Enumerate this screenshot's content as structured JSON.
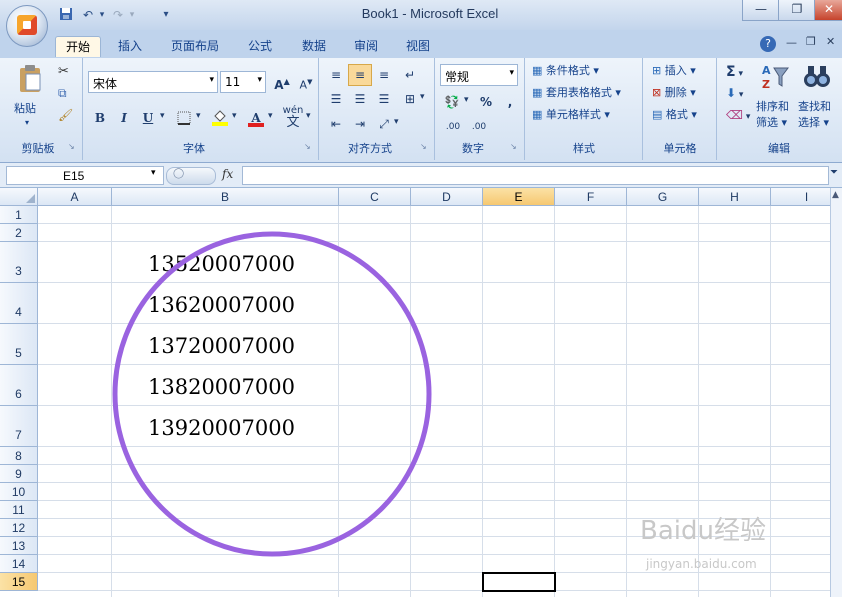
{
  "window": {
    "title": "Book1 - Microsoft Excel"
  },
  "quick_access": {
    "save_icon": "save-icon",
    "undo_icon": "undo-icon",
    "redo_icon": "redo-icon"
  },
  "ribbon_tabs": [
    "开始",
    "插入",
    "页面布局",
    "公式",
    "数据",
    "审阅",
    "视图"
  ],
  "clipboard": {
    "paste_label": "粘贴",
    "group_label": "剪贴板"
  },
  "font": {
    "name": "宋体",
    "size": "11",
    "group_label": "字体",
    "bold": "B",
    "italic": "I",
    "underline": "U",
    "color_letter": "A",
    "phonetic": "wén",
    "phonetic_char": "文",
    "grow": "A",
    "shrink": "A"
  },
  "alignment": {
    "group_label": "对齐方式"
  },
  "number": {
    "format": "常规",
    "group_label": "数字",
    "percent": "%",
    "comma": ",",
    "inc_decimal": ".00",
    "dec_decimal": ".00"
  },
  "styles": {
    "conditional": "条件格式",
    "table": "套用表格格式",
    "cell_styles": "单元格样式",
    "group_label": "样式"
  },
  "cells": {
    "insert": "插入",
    "delete": "删除",
    "format": "格式",
    "group_label": "单元格"
  },
  "editing": {
    "sort_l1": "排序和",
    "sort_l2": "筛选",
    "find_l1": "查找和",
    "find_l2": "选择",
    "group_label": "编辑",
    "sum": "Σ"
  },
  "formula_bar": {
    "name_box": "E15",
    "fx": "fx",
    "content": ""
  },
  "columns": [
    "A",
    "B",
    "C",
    "D",
    "E",
    "F",
    "G",
    "H",
    "I"
  ],
  "rows": [
    "1",
    "2",
    "3",
    "4",
    "5",
    "6",
    "7",
    "8",
    "9",
    "10",
    "11",
    "12",
    "13",
    "14",
    "15"
  ],
  "cells_data": [
    "13520007000",
    "13620007000",
    "13720007000",
    "13820007000",
    "13920007000"
  ],
  "annotation_color": "#9a63e0",
  "watermark": {
    "brand": "Baidu经验",
    "url": "jingyan.baidu.com"
  }
}
